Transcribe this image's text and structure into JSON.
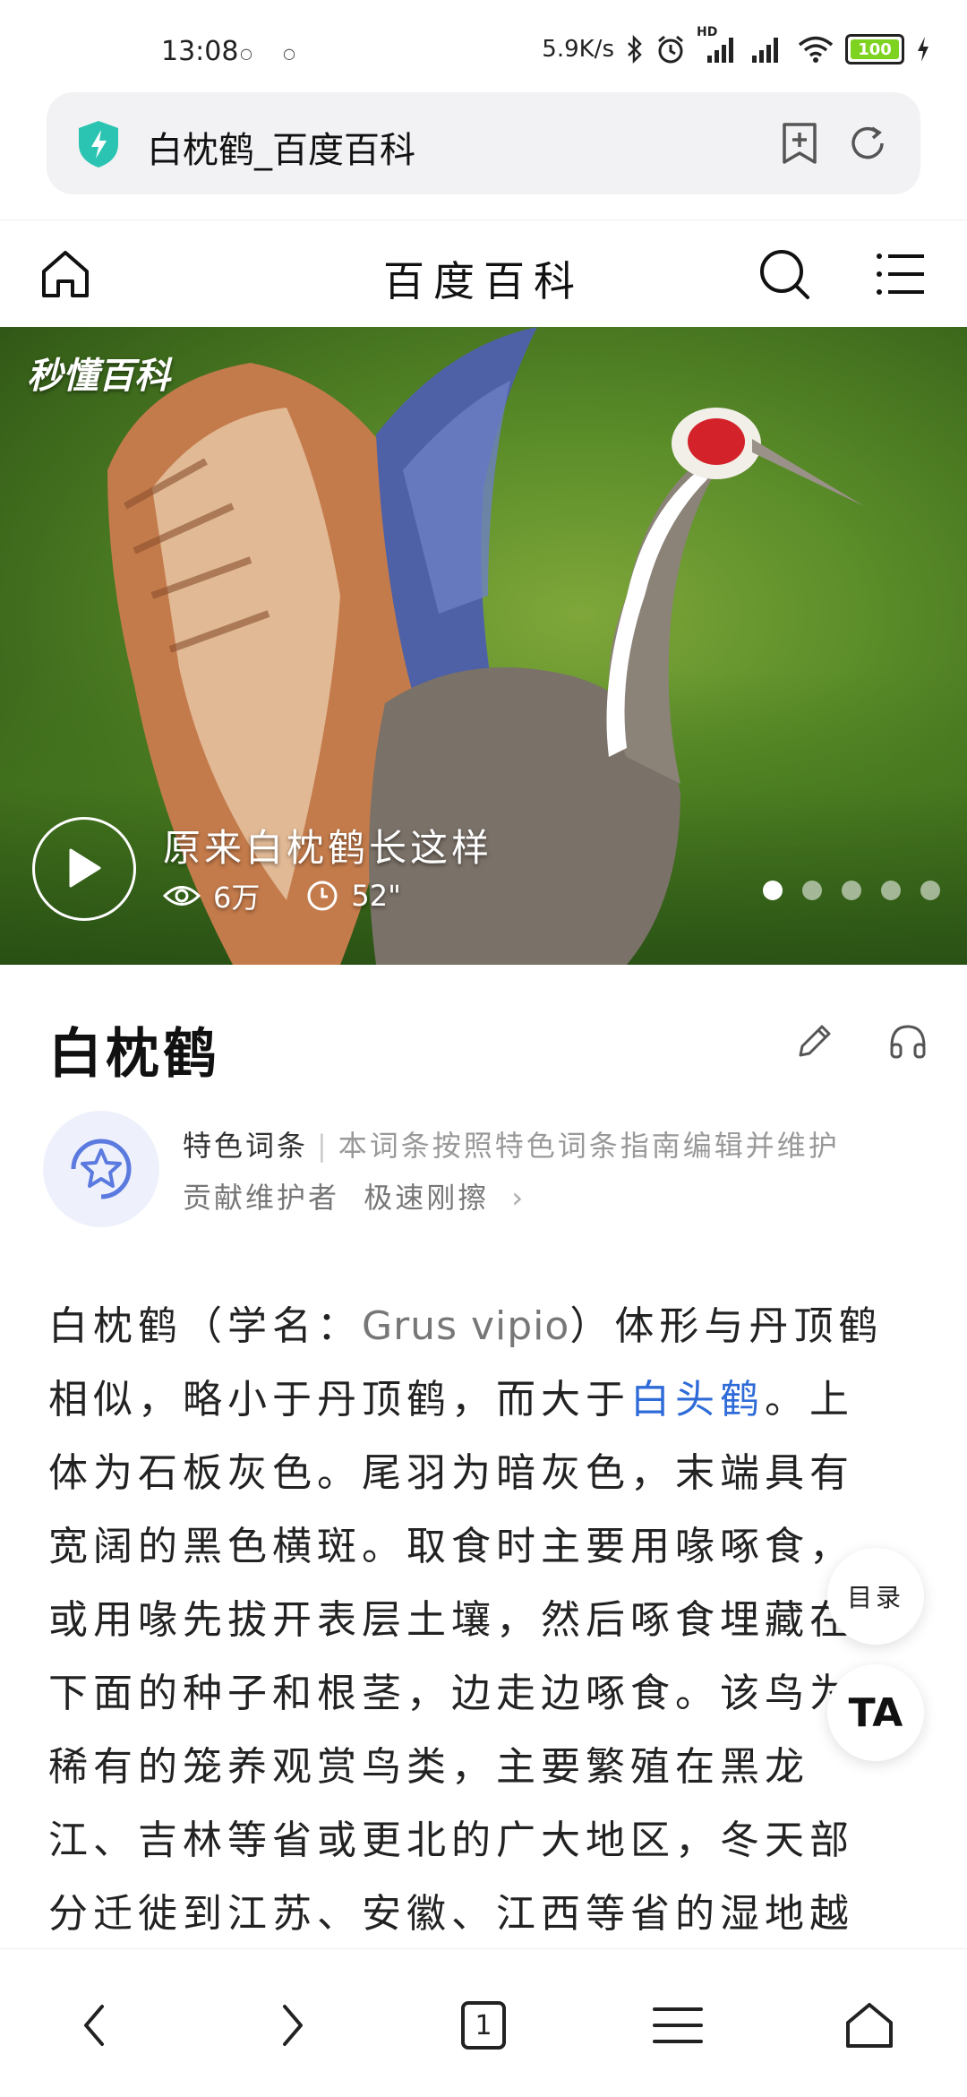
{
  "status_bar": {
    "time": "13:08",
    "network_speed": "5.9K/s",
    "hd_label": "HD",
    "battery_level": "100",
    "icons": [
      "bluetooth-icon",
      "alarm-icon",
      "signal-icon",
      "wifi-icon",
      "battery-icon",
      "charging-icon"
    ]
  },
  "address_bar": {
    "page_title": "白枕鹤_百度百科",
    "icons": [
      "shield-icon",
      "add-bookmark-icon",
      "refresh-icon"
    ]
  },
  "site_header": {
    "brand": "百度百科",
    "icons": [
      "home-icon",
      "search-icon",
      "menu-icon"
    ]
  },
  "video": {
    "logo": "秒懂百科",
    "title": "原来白枕鹤长这样",
    "views": "6万",
    "duration": "52\"",
    "dot_count": 5,
    "active_dot": 0
  },
  "entry": {
    "title": "白枕鹤",
    "feature_label": "特色词条",
    "feature_desc": "本词条按照特色词条指南编辑并维护",
    "contributor_label": "贡献维护者",
    "contributor_name": "极速刚擦",
    "contributor_chevron": "›"
  },
  "body": {
    "intro_prefix": "白枕鹤（学名：",
    "latin_name": "Grus vipio",
    "intro_mid": "）体形与丹顶鹤相似，略小于丹顶鹤，而大于",
    "link_text": "白头鹤",
    "intro_rest": "。上体为石板灰色。尾羽为暗灰色，末端具有宽阔的黑色横斑。取食时主要用喙啄食，或用喙先拔开表层土壤，然后啄食埋藏在下面的种子和根茎，边走边啄食。该鸟为稀有的笼养观赏鸟类，主要繁殖在黑龙江、吉林等省或更北的广大地区，冬天部分迁徙到江苏、安徽、江西等省的湿地越冬。白枕鹤为中国国"
  },
  "floating": {
    "toc_label": "目录",
    "text_size_label": "TA"
  },
  "bottom_nav": {
    "tab_count": "1",
    "icons": [
      "back-icon",
      "forward-icon",
      "tabs-icon",
      "menu-icon",
      "home-icon"
    ]
  },
  "colors": {
    "accent_link": "#2e6bd8",
    "shield": "#2bc4b2",
    "battery_fill": "#7ed321",
    "feature_badge_bg": "#eef1fb",
    "feature_icon": "#5b7ae0"
  }
}
